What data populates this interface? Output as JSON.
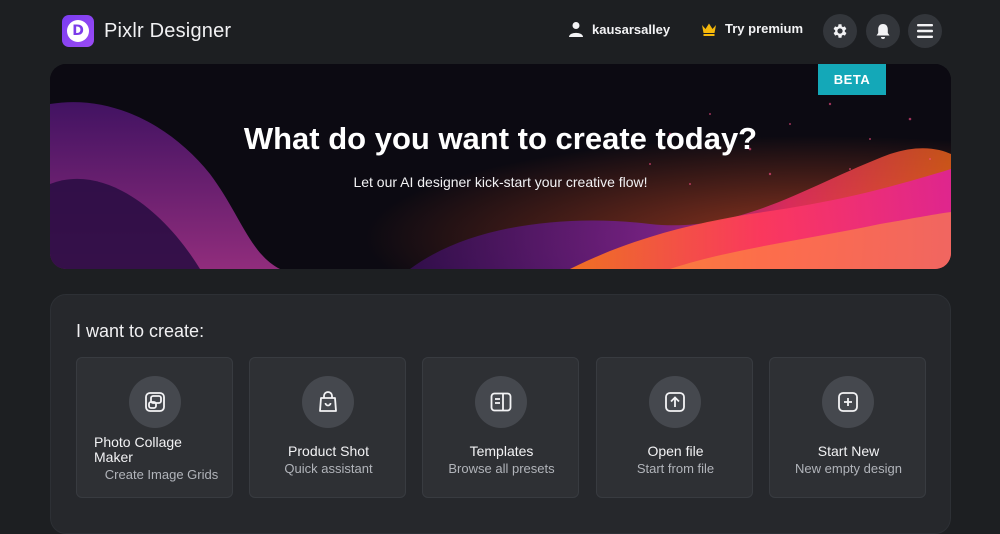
{
  "app": {
    "name": "Pixlr Designer",
    "logo_letter": "D"
  },
  "header": {
    "username": "kausarsalley",
    "premium_label": "Try premium",
    "icons": [
      "user-icon",
      "crown-icon",
      "gear-icon",
      "bell-icon",
      "menu-icon"
    ]
  },
  "hero": {
    "badge": "BETA",
    "title": "What do you want to create today?",
    "subtitle": "Let our AI designer kick-start your creative flow!"
  },
  "create": {
    "heading": "I want to create:",
    "cards": [
      {
        "title": "Photo Collage Maker",
        "subtitle": "Create Image Grids",
        "icon": "collage-icon"
      },
      {
        "title": "Product Shot",
        "subtitle": "Quick assistant",
        "icon": "shopping-bag-icon"
      },
      {
        "title": "Templates",
        "subtitle": "Browse all presets",
        "icon": "templates-icon"
      },
      {
        "title": "Open file",
        "subtitle": "Start from file",
        "icon": "upload-icon"
      },
      {
        "title": "Start New",
        "subtitle": "New empty design",
        "icon": "plus-square-icon"
      }
    ]
  },
  "colors": {
    "background": "#1d1f22",
    "panel": "#26282c",
    "card": "#2e3034",
    "brand_purple": "#7a3cf0",
    "beta_teal": "#14a8b8",
    "crown_gold": "#f5b80b"
  }
}
